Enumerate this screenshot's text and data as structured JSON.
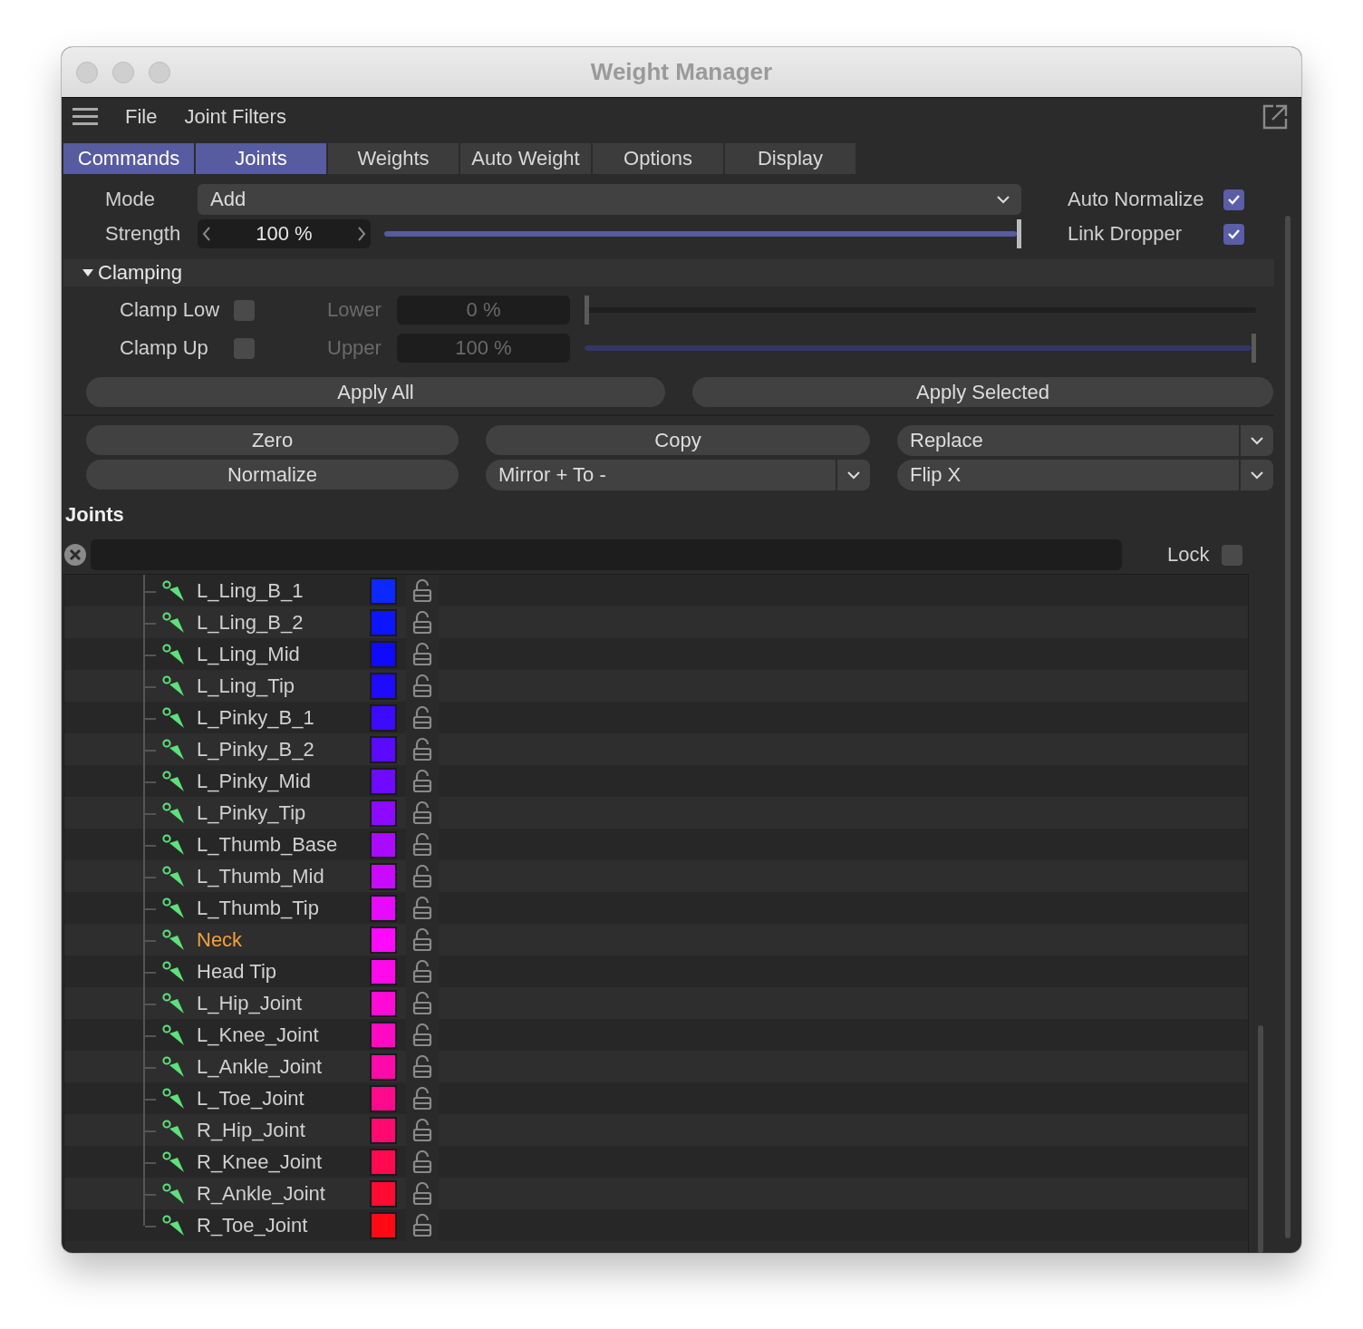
{
  "window": {
    "title": "Weight Manager"
  },
  "menu": [
    "File",
    "Joint Filters"
  ],
  "tabs": [
    {
      "label": "Commands",
      "selected": true
    },
    {
      "label": "Joints",
      "selected": true
    },
    {
      "label": "Weights",
      "selected": false
    },
    {
      "label": "Auto Weight",
      "selected": false
    },
    {
      "label": "Options",
      "selected": false
    },
    {
      "label": "Display",
      "selected": false
    }
  ],
  "mode": {
    "label": "Mode",
    "value": "Add"
  },
  "auto_normalize": {
    "label": "Auto Normalize",
    "checked": true
  },
  "strength": {
    "label": "Strength",
    "value": "100 %",
    "level": 1
  },
  "link_dropper": {
    "label": "Link Dropper",
    "checked": true
  },
  "clamping": {
    "title": "Clamping",
    "expanded": true,
    "rows": [
      {
        "label": "Clamp Low",
        "checked": false,
        "field_label": "Lower",
        "value": "0 %",
        "level": 0
      },
      {
        "label": "Clamp Up",
        "checked": false,
        "field_label": "Upper",
        "value": "100 %",
        "level": 1
      }
    ]
  },
  "apply_buttons": [
    "Apply All",
    "Apply Selected"
  ],
  "commands": [
    {
      "kind": "button",
      "label": "Zero"
    },
    {
      "kind": "button",
      "label": "Copy"
    },
    {
      "kind": "dropdown",
      "label": "Replace"
    },
    {
      "kind": "button",
      "label": "Normalize"
    },
    {
      "kind": "dropdown",
      "label": "Mirror + To -"
    },
    {
      "kind": "dropdown",
      "label": "Flip X"
    }
  ],
  "joints": {
    "title": "Joints",
    "lock": {
      "label": "Lock",
      "checked": false
    },
    "items": [
      {
        "name": "L_Ling_B_1",
        "color": "#0a28ff",
        "highlighted": false,
        "locked": false
      },
      {
        "name": "L_Ling_B_2",
        "color": "#0d14ff",
        "highlighted": false,
        "locked": false
      },
      {
        "name": "L_Ling_Mid",
        "color": "#0f0aff",
        "highlighted": false,
        "locked": false
      },
      {
        "name": "L_Ling_Tip",
        "color": "#1e0aff",
        "highlighted": false,
        "locked": false
      },
      {
        "name": "L_Pinky_B_1",
        "color": "#3c0aff",
        "highlighted": false,
        "locked": false
      },
      {
        "name": "L_Pinky_B_2",
        "color": "#5a0aff",
        "highlighted": false,
        "locked": false
      },
      {
        "name": "L_Pinky_Mid",
        "color": "#6e0aff",
        "highlighted": false,
        "locked": false
      },
      {
        "name": "L_Pinky_Tip",
        "color": "#8c0aff",
        "highlighted": false,
        "locked": false
      },
      {
        "name": "L_Thumb_Base",
        "color": "#aa0aff",
        "highlighted": false,
        "locked": false
      },
      {
        "name": "L_Thumb_Mid",
        "color": "#c80aff",
        "highlighted": false,
        "locked": false
      },
      {
        "name": "L_Thumb_Tip",
        "color": "#e60aff",
        "highlighted": false,
        "locked": false
      },
      {
        "name": "Neck",
        "color": "#ff0aff",
        "highlighted": true,
        "locked": false
      },
      {
        "name": "Head Tip",
        "color": "#ff0aeb",
        "highlighted": false,
        "locked": false
      },
      {
        "name": "L_Hip_Joint",
        "color": "#ff0ad7",
        "highlighted": false,
        "locked": false
      },
      {
        "name": "L_Knee_Joint",
        "color": "#ff0ac3",
        "highlighted": false,
        "locked": false
      },
      {
        "name": "L_Ankle_Joint",
        "color": "#ff0aaa",
        "highlighted": false,
        "locked": false
      },
      {
        "name": "L_Toe_Joint",
        "color": "#ff0a8c",
        "highlighted": false,
        "locked": false
      },
      {
        "name": "R_Hip_Joint",
        "color": "#ff0a6e",
        "highlighted": false,
        "locked": false
      },
      {
        "name": "R_Knee_Joint",
        "color": "#ff0a50",
        "highlighted": false,
        "locked": false
      },
      {
        "name": "R_Ankle_Joint",
        "color": "#ff0a32",
        "highlighted": false,
        "locked": false
      },
      {
        "name": "R_Toe_Joint",
        "color": "#ff0a14",
        "highlighted": false,
        "locked": false
      }
    ]
  }
}
